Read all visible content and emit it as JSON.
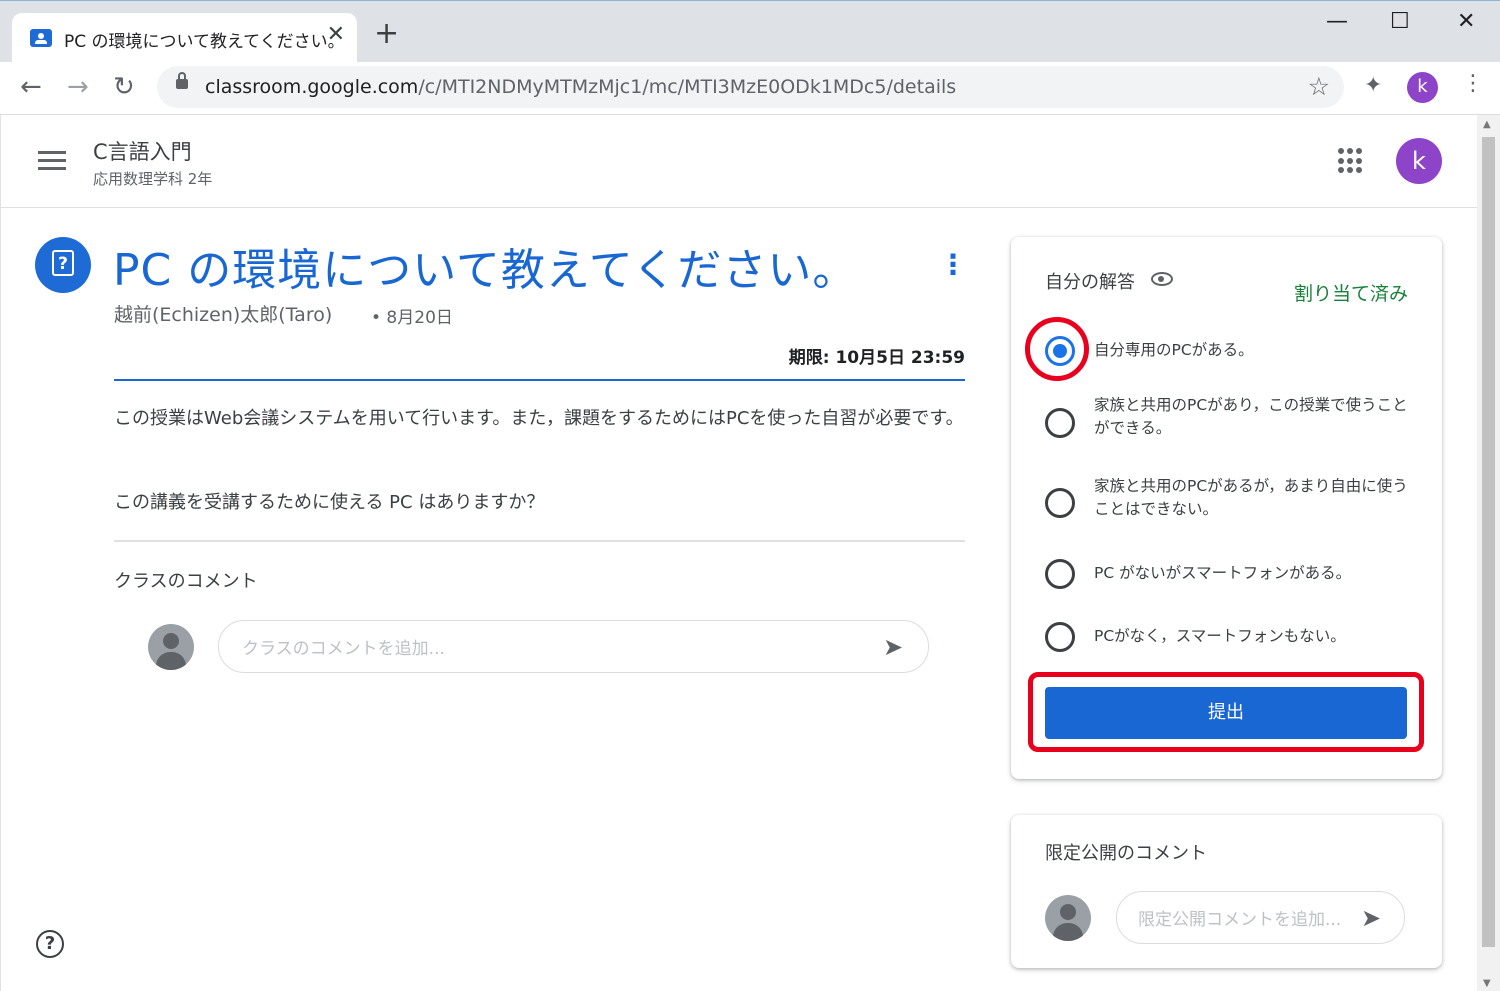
{
  "browser": {
    "tab_title": "PC の環境について教えてください。",
    "tab_close": "✕",
    "new_tab": "+",
    "url_host": "classroom.google.com",
    "url_path": "/c/MTI2NDMyMTMzMjc1/mc/MTI3MzE0ODk1MDc5/details",
    "profile_initial": "k",
    "minimize": "—",
    "maximize": "☐",
    "close": "✕",
    "back": "←",
    "forward": "→",
    "reload": "↻",
    "star": "☆",
    "extensions": "✦",
    "menu": "⋮"
  },
  "header": {
    "course_title": "C言語入門",
    "course_subtitle": "応用数理学科 2年",
    "profile_initial": "k"
  },
  "assignment": {
    "title": "PC の環境について教えてください。",
    "author": "越前(Echizen)太郎(Taro)",
    "date": "• 8月20日",
    "due": "期限: 10月5日 23:59",
    "body": "この授業はWeb会議システムを用いて行います。また，課題をするためにはPCを使った自習が必要です。",
    "question": "この講義を受講するために使える PC はありますか？",
    "kebab": "⋮"
  },
  "class_comments": {
    "label": "クラスのコメント",
    "placeholder": "クラスのコメントを追加..."
  },
  "answer_card": {
    "title": "自分の解答",
    "status": "割り当て済み",
    "options": [
      {
        "label": "自分専用のPCがある。",
        "checked": true
      },
      {
        "label": "家族と共用のPCがあり，この授業で使うことができる。",
        "checked": false
      },
      {
        "label": "家族と共用のPCがあるが，あまり自由に使うことはできない。",
        "checked": false
      },
      {
        "label": "PC がないがスマートフォンがある。",
        "checked": false
      },
      {
        "label": "PCがなく，スマートフォンもない。",
        "checked": false
      }
    ],
    "submit_label": "提出"
  },
  "private_comments": {
    "title": "限定公開のコメント",
    "placeholder": "限定公開コメントを追加..."
  },
  "icons": {
    "help": "?",
    "send": "➤"
  },
  "colors": {
    "accent": "#1967d2",
    "status_green": "#188038",
    "highlight_ring": "#e8001c",
    "avatar_purple": "#8e44c8"
  }
}
